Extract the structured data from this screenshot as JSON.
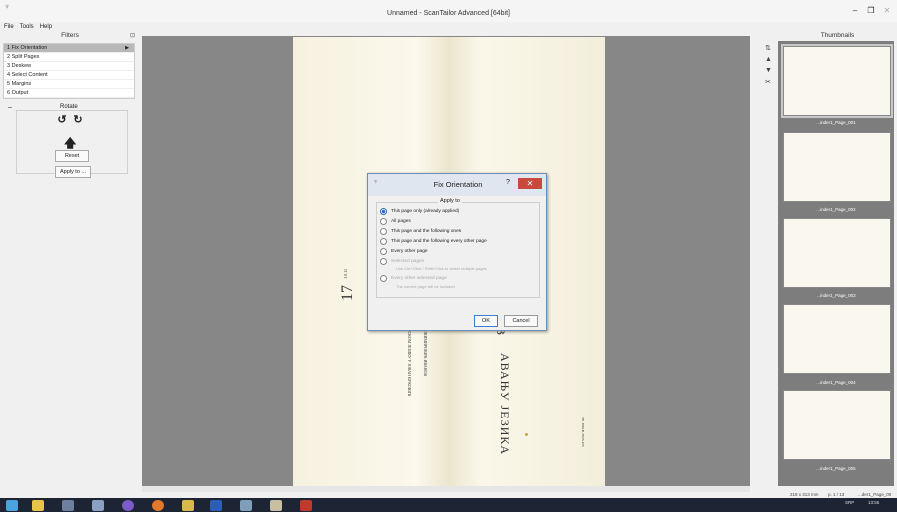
{
  "window": {
    "title": "Unnamed - ScanTailor Advanced [64bit]",
    "controls": {
      "minimize": "–",
      "maximize": "❐",
      "close": "✕"
    }
  },
  "menu": [
    "File",
    "Tools",
    "Help"
  ],
  "filters": {
    "header": "Filters",
    "items": [
      {
        "num": "1",
        "label": "Fix Orientation"
      },
      {
        "num": "2",
        "label": "Split Pages"
      },
      {
        "num": "3",
        "label": "Deskew"
      },
      {
        "num": "4",
        "label": "Select Content"
      },
      {
        "num": "5",
        "label": "Margins"
      },
      {
        "num": "6",
        "label": "Output"
      }
    ],
    "active_index": 0,
    "rotate": {
      "title": "Rotate",
      "collapse": "–",
      "reset_label": "Reset"
    },
    "apply_label": "Apply to ..."
  },
  "page_text": {
    "number": "17",
    "number_sub": "1.0.11",
    "col1": "ЗВ",
    "col2": "АВАЊУ ЈЕЗИКА",
    "col3": "ХРВАТСКОМ ЈЕЗИКУ У ЈОВАН ВУКОВИЋ",
    "col4": "НОВИМИРОВИЋ ИВАНОВ",
    "col5": "ТЕ. ПРАВ. 8905.105"
  },
  "dialog": {
    "title": "Fix Orientation",
    "help": "?",
    "close": "✕",
    "group_title": "Apply to",
    "options": [
      {
        "label": "This page only (already applied)",
        "checked": true,
        "enabled": true
      },
      {
        "label": "All pages",
        "checked": false,
        "enabled": true
      },
      {
        "label": "This page and the following ones",
        "checked": false,
        "enabled": true
      },
      {
        "label": "This page and the following every other page",
        "checked": false,
        "enabled": true
      },
      {
        "label": "Every other page",
        "checked": false,
        "enabled": true
      },
      {
        "label": "Selected pages",
        "checked": false,
        "enabled": false
      },
      {
        "label": "Every other selected page",
        "checked": false,
        "enabled": false
      }
    ],
    "hint_selected": "Use Ctrl+Click / Shift+Click to select multiple pages",
    "hint_every_other": "The current page will be included",
    "ok_label": "OK",
    "cancel_label": "Cancel"
  },
  "thumbnails": {
    "header": "Thumbnails",
    "items": [
      {
        "label": "...inder1_Page_001"
      },
      {
        "label": "...inder1_Page_002"
      },
      {
        "label": "...inder1_Page_003"
      },
      {
        "label": "...inder1_Page_004"
      },
      {
        "label": "...inder1_Page_005"
      }
    ]
  },
  "status": {
    "dimensions": "218 x 313 mm",
    "page": "p. 1 / 13",
    "file": "...der1_Page_00"
  },
  "tray": {
    "lang": "SRP",
    "time": "13:55"
  },
  "taskbar_apps": [
    "windows-start-icon",
    "file-explorer-icon",
    "app-icon-1",
    "app-icon-2",
    "viber-icon",
    "firefox-icon",
    "app-icon-3",
    "word-icon",
    "app-icon-4",
    "scantailor-icon",
    "app-icon-5"
  ]
}
